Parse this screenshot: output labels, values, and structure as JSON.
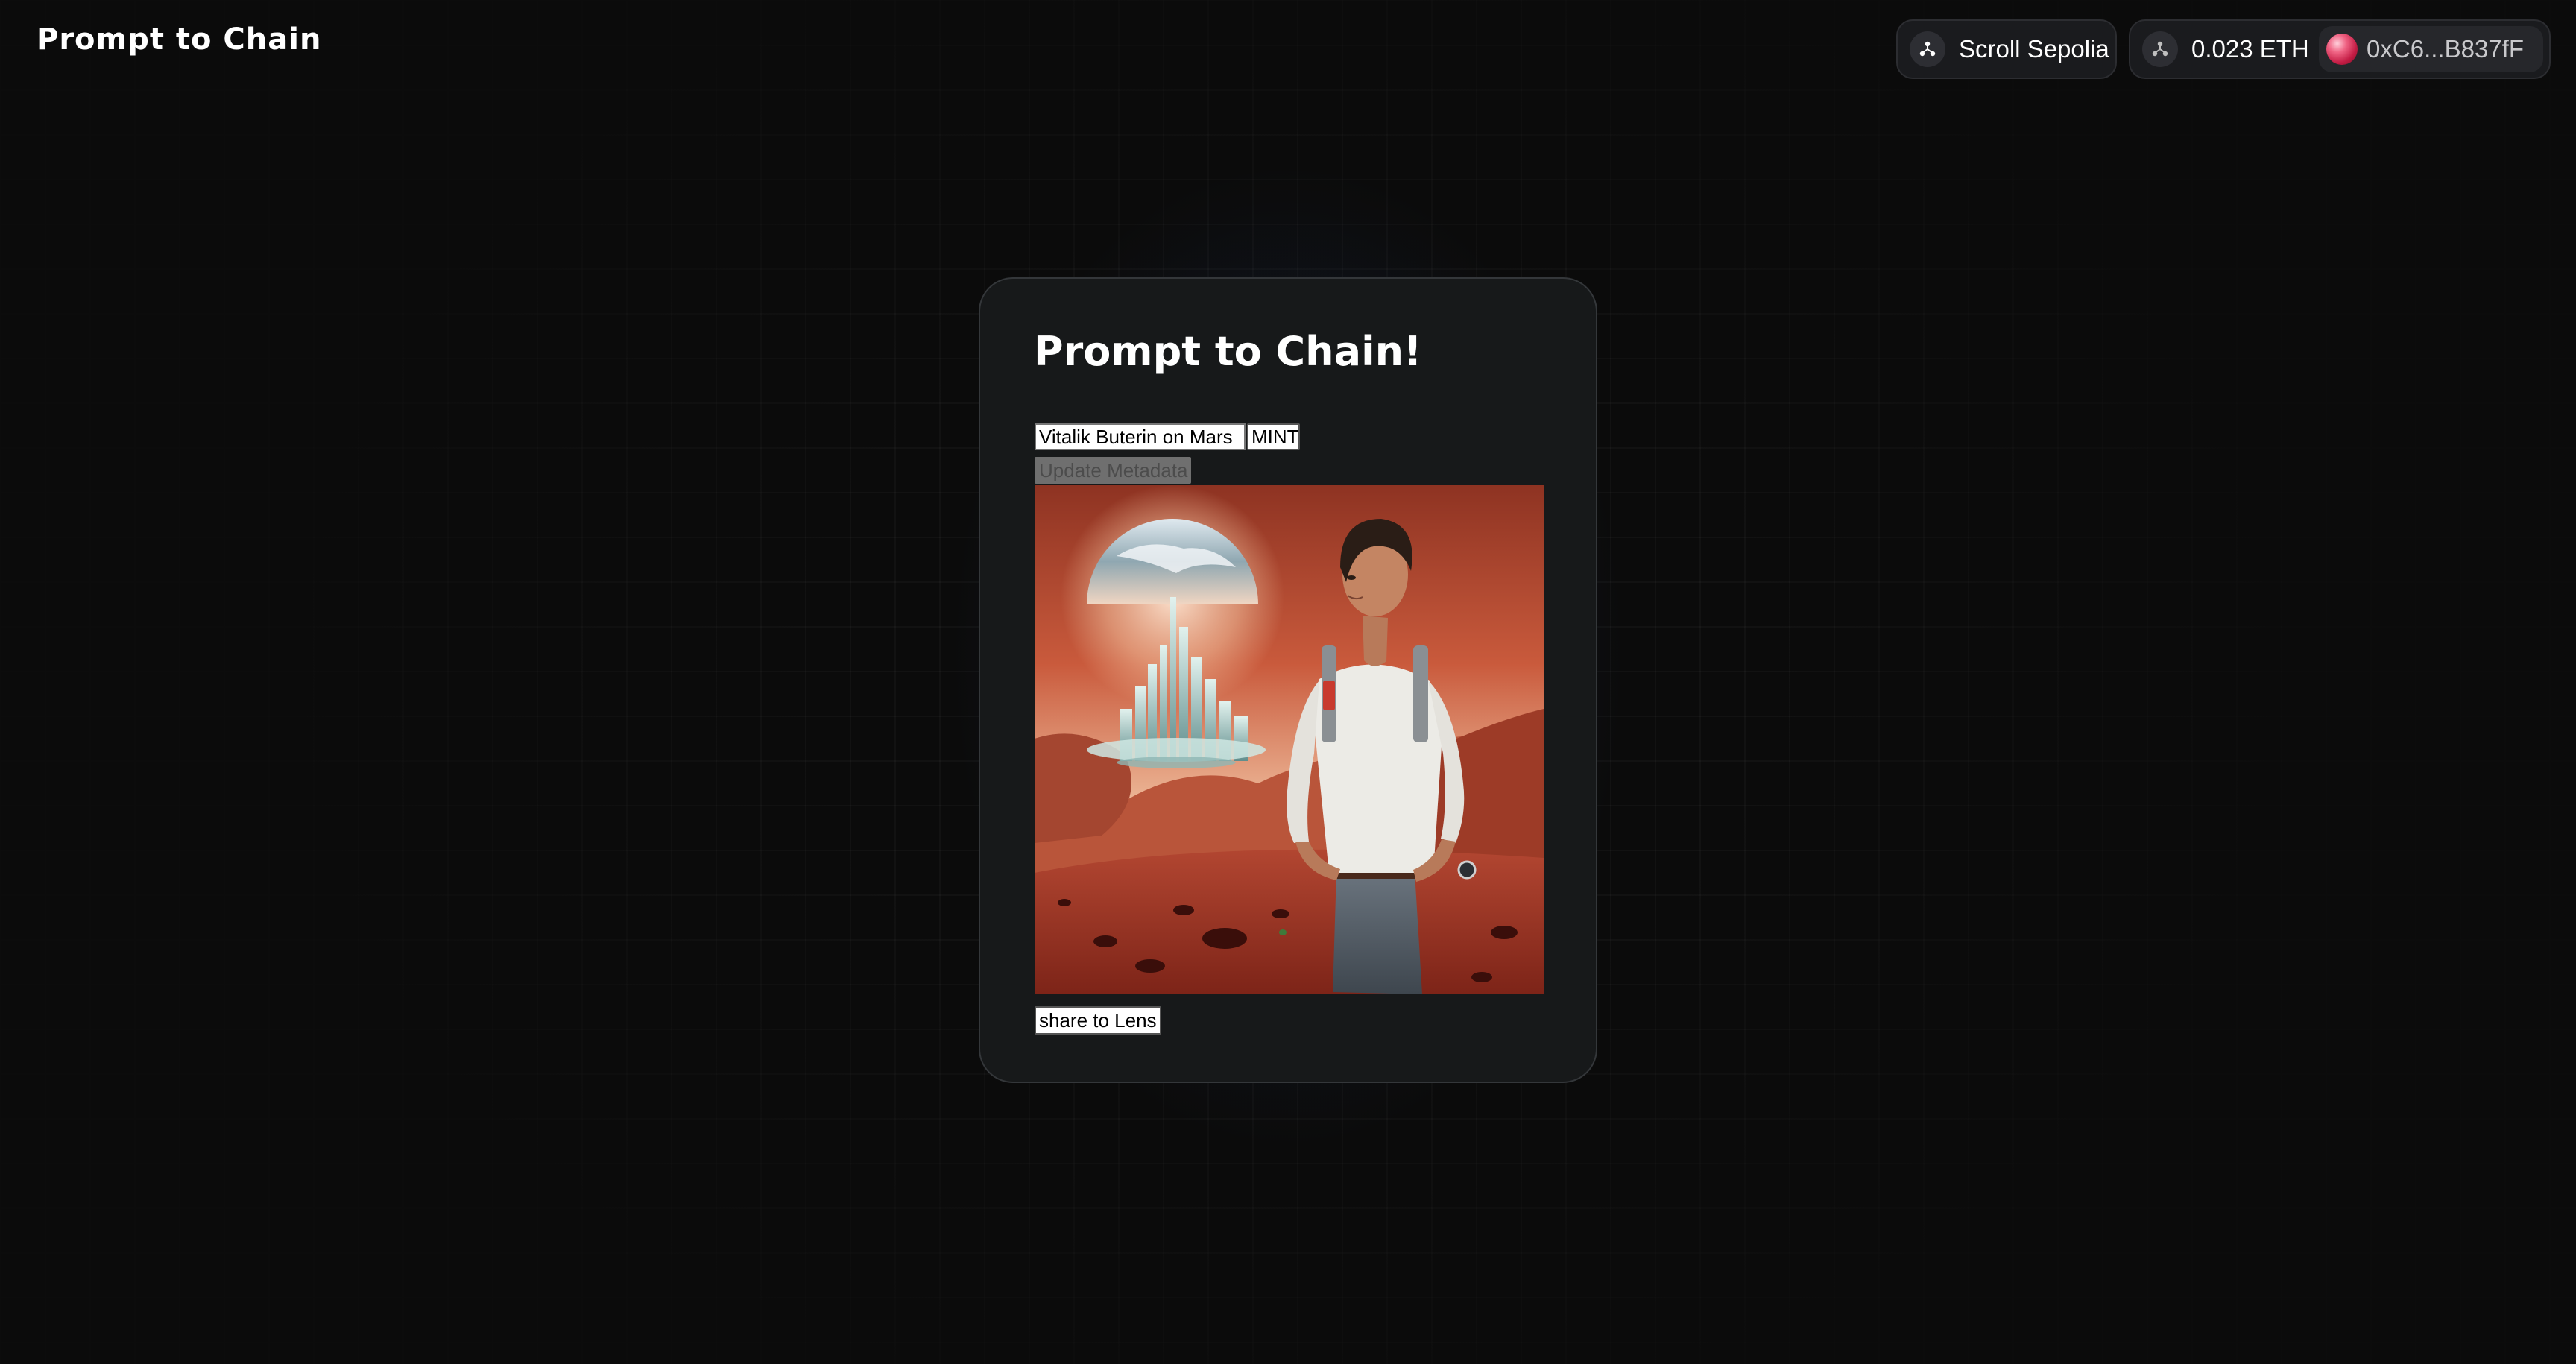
{
  "header": {
    "app_title": "Prompt to Chain",
    "network": {
      "icon": "scroll-chain-icon",
      "name": "Scroll Sepolia"
    },
    "wallet": {
      "icon": "scroll-chain-icon",
      "balance": "0.023 ETH",
      "avatar": "wallet-avatar",
      "address": "0xC6...B837fF"
    }
  },
  "card": {
    "title": "Prompt to Chain!",
    "prompt_value": "Vitalik Buterin on Mars",
    "mint_label": "MINT",
    "update_label": "Update Metadata",
    "share_label": "share to Lens"
  },
  "colors": {
    "background": "#0b0b0b",
    "card_background": "#17191a",
    "pill_background": "#1a1b1e",
    "glow": "#304e80"
  }
}
